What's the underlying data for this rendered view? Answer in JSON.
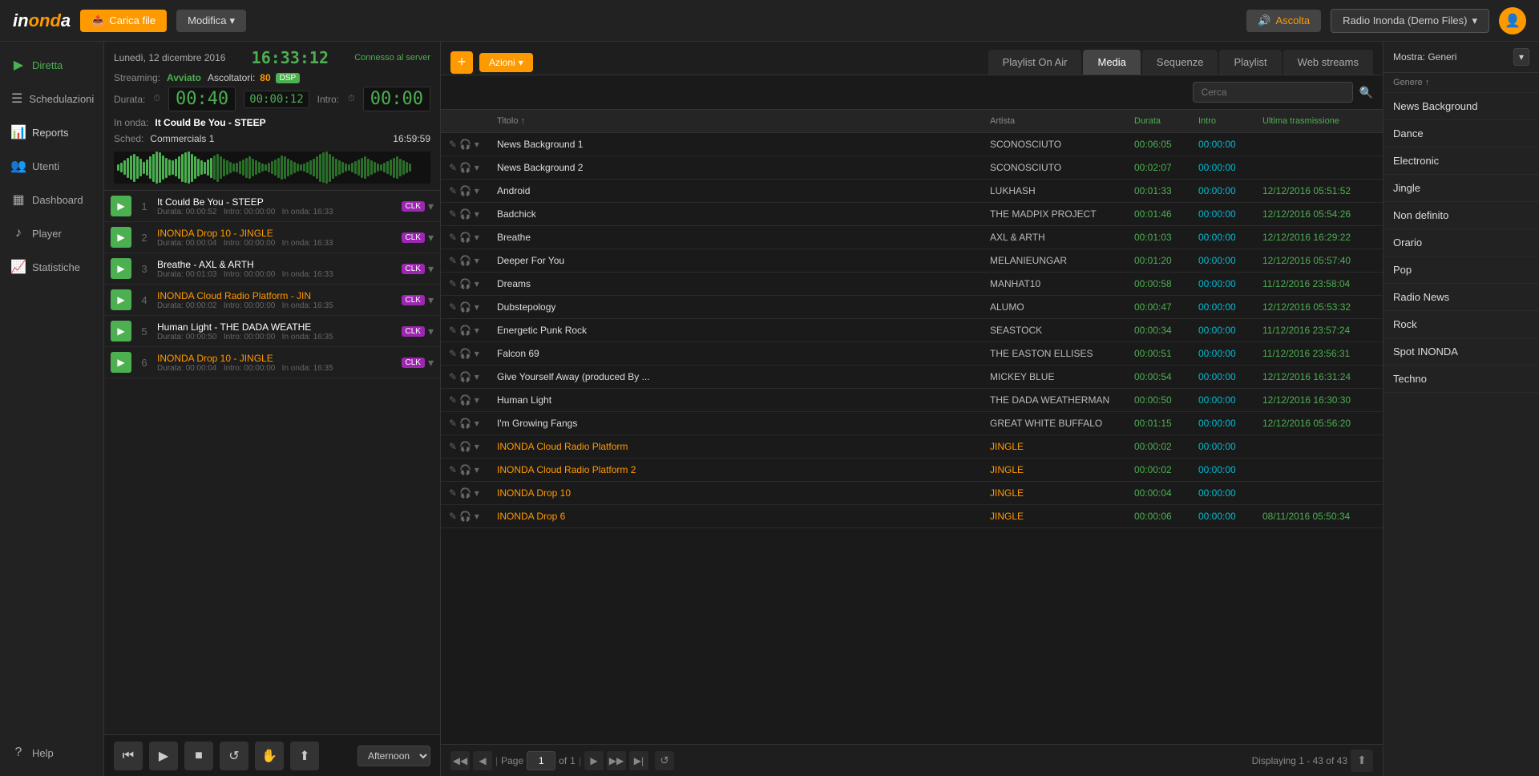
{
  "topbar": {
    "logo_text": "inonda",
    "carica_label": "Carica file",
    "modifica_label": "Modifica",
    "ascolta_label": "Ascolta",
    "radio_label": "Radio Inonda (Demo Files)",
    "user_icon": "👤"
  },
  "sidebar": {
    "items": [
      {
        "id": "diretta",
        "label": "Diretta",
        "icon": "▶"
      },
      {
        "id": "schedulazioni",
        "label": "Schedulazioni",
        "icon": "📅"
      },
      {
        "id": "reports",
        "label": "Reports",
        "icon": "📊"
      },
      {
        "id": "utenti",
        "label": "Utenti",
        "icon": "👥"
      },
      {
        "id": "dashboard",
        "label": "Dashboard",
        "icon": "📋"
      },
      {
        "id": "player",
        "label": "Player",
        "icon": "🎵"
      },
      {
        "id": "statistiche",
        "label": "Statistiche",
        "icon": "📈"
      },
      {
        "id": "help",
        "label": "Help",
        "icon": "?"
      }
    ]
  },
  "middle": {
    "date_label": "Lunedì, 12 dicembre 2016",
    "clock": "16:33:12",
    "connected_label": "Connesso al server",
    "streaming_label": "Streaming:",
    "streaming_status": "Avviato",
    "listeners_label": "Ascoltatori:",
    "listeners_num": "80",
    "dsp_label": "DSP",
    "duration_label": "Durata:",
    "duration_display": "00:40",
    "duration_small": "00:00:12",
    "intro_label": "Intro:",
    "intro_display": "00:00",
    "in_onda_label": "In onda:",
    "in_onda_val": "It Could Be You - STEEP",
    "sched_label": "Sched:",
    "sched_val": "Commercials 1",
    "sched_time": "16:59:59"
  },
  "playlist": {
    "items": [
      {
        "num": "1",
        "title": "It Could Be You - STEEP",
        "jingle": false,
        "duration": "00:00:52",
        "intro": "00:00:00",
        "on_onda": "16:33",
        "clk": true
      },
      {
        "num": "2",
        "title": "INONDA Drop 10 - JINGLE",
        "jingle": true,
        "duration": "00:00:04",
        "intro": "00:00:00",
        "on_onda": "16:33",
        "clk": true
      },
      {
        "num": "3",
        "title": "Breathe - AXL & ARTH",
        "jingle": false,
        "duration": "00:01:03",
        "intro": "00:00:00",
        "on_onda": "16:33",
        "clk": true
      },
      {
        "num": "4",
        "title": "INONDA Cloud Radio Platform - JIN",
        "jingle": true,
        "duration": "00:00:02",
        "intro": "00:00:00",
        "on_onda": "16:35",
        "clk": true
      },
      {
        "num": "5",
        "title": "Human Light - THE DADA WEATHE",
        "jingle": false,
        "duration": "00:00:50",
        "intro": "00:00:00",
        "on_onda": "16:35",
        "clk": true
      },
      {
        "num": "6",
        "title": "INONDA Drop 10 - JINGLE",
        "jingle": true,
        "duration": "00:00:04",
        "intro": "00:00:00",
        "on_onda": "16:35",
        "clk": true
      }
    ]
  },
  "transport": {
    "afternoon_label": "Afternoon"
  },
  "tabs": {
    "items": [
      {
        "id": "playlist-on-air",
        "label": "Playlist On Air"
      },
      {
        "id": "media",
        "label": "Media"
      },
      {
        "id": "sequenze",
        "label": "Sequenze"
      },
      {
        "id": "playlist",
        "label": "Playlist"
      },
      {
        "id": "web-streams",
        "label": "Web streams"
      }
    ],
    "active": "media",
    "azioni_label": "Azioni",
    "search_placeholder": "Cerca"
  },
  "table": {
    "columns": [
      {
        "id": "actions",
        "label": ""
      },
      {
        "id": "title",
        "label": "Titolo ↑"
      },
      {
        "id": "artist",
        "label": "Artista"
      },
      {
        "id": "duration",
        "label": "Durata"
      },
      {
        "id": "intro",
        "label": "Intro"
      },
      {
        "id": "last_transmission",
        "label": "Ultima trasmissione"
      }
    ],
    "rows": [
      {
        "title": "News Background 1",
        "artist": "SCONOSCIUTO",
        "duration": "00:06:05",
        "intro": "00:00:00",
        "last": "",
        "jingle": false
      },
      {
        "title": "News Background 2",
        "artist": "SCONOSCIUTO",
        "duration": "00:02:07",
        "intro": "00:00:00",
        "last": "",
        "jingle": false
      },
      {
        "title": "Android",
        "artist": "LUKHASH",
        "duration": "00:01:33",
        "intro": "00:00:00",
        "last": "12/12/2016 05:51:52",
        "jingle": false
      },
      {
        "title": "Badchick",
        "artist": "THE MADPIX PROJECT",
        "duration": "00:01:46",
        "intro": "00:00:00",
        "last": "12/12/2016 05:54:26",
        "jingle": false
      },
      {
        "title": "Breathe",
        "artist": "AXL & ARTH",
        "duration": "00:01:03",
        "intro": "00:00:00",
        "last": "12/12/2016 16:29:22",
        "jingle": false
      },
      {
        "title": "Deeper For You",
        "artist": "MELANIEUNGAR",
        "duration": "00:01:20",
        "intro": "00:00:00",
        "last": "12/12/2016 05:57:40",
        "jingle": false
      },
      {
        "title": "Dreams",
        "artist": "MANHAT10",
        "duration": "00:00:58",
        "intro": "00:00:00",
        "last": "11/12/2016 23:58:04",
        "jingle": false
      },
      {
        "title": "Dubstepology",
        "artist": "ALUMO",
        "duration": "00:00:47",
        "intro": "00:00:00",
        "last": "12/12/2016 05:53:32",
        "jingle": false
      },
      {
        "title": "Energetic Punk Rock",
        "artist": "SEASTOCK",
        "duration": "00:00:34",
        "intro": "00:00:00",
        "last": "11/12/2016 23:57:24",
        "jingle": false
      },
      {
        "title": "Falcon 69",
        "artist": "THE EASTON ELLISES",
        "duration": "00:00:51",
        "intro": "00:00:00",
        "last": "11/12/2016 23:56:31",
        "jingle": false
      },
      {
        "title": "Give Yourself Away (produced By ...",
        "artist": "MICKEY BLUE",
        "duration": "00:00:54",
        "intro": "00:00:00",
        "last": "12/12/2016 16:31:24",
        "jingle": false
      },
      {
        "title": "Human Light",
        "artist": "THE DADA WEATHERMAN",
        "duration": "00:00:50",
        "intro": "00:00:00",
        "last": "12/12/2016 16:30:30",
        "jingle": false
      },
      {
        "title": "I'm Growing Fangs",
        "artist": "GREAT WHITE BUFFALO",
        "duration": "00:01:15",
        "intro": "00:00:00",
        "last": "12/12/2016 05:56:20",
        "jingle": false
      },
      {
        "title": "INONDA Cloud Radio Platform",
        "artist": "JINGLE",
        "duration": "00:00:02",
        "intro": "00:00:00",
        "last": "",
        "jingle": true
      },
      {
        "title": "INONDA Cloud Radio Platform 2",
        "artist": "JINGLE",
        "duration": "00:00:02",
        "intro": "00:00:00",
        "last": "",
        "jingle": true
      },
      {
        "title": "INONDA Drop 10",
        "artist": "JINGLE",
        "duration": "00:00:04",
        "intro": "00:00:00",
        "last": "",
        "jingle": true
      },
      {
        "title": "INONDA Drop 6",
        "artist": "JINGLE",
        "duration": "00:00:06",
        "intro": "00:00:00",
        "last": "08/11/2016 05:50:34",
        "jingle": true
      }
    ],
    "pagination": {
      "page_label": "Page",
      "page_num": "1",
      "of_label": "of",
      "total_pages": "1",
      "displaying": "Displaying 1 - 43 of 43"
    }
  },
  "genres": {
    "mostra_label": "Mostra: Generi",
    "col_header": "Genere ↑",
    "items": [
      "News Background",
      "Dance",
      "Electronic",
      "Jingle",
      "Non definito",
      "Orario",
      "Pop",
      "Radio News",
      "Rock",
      "Spot INONDA",
      "Techno"
    ]
  }
}
